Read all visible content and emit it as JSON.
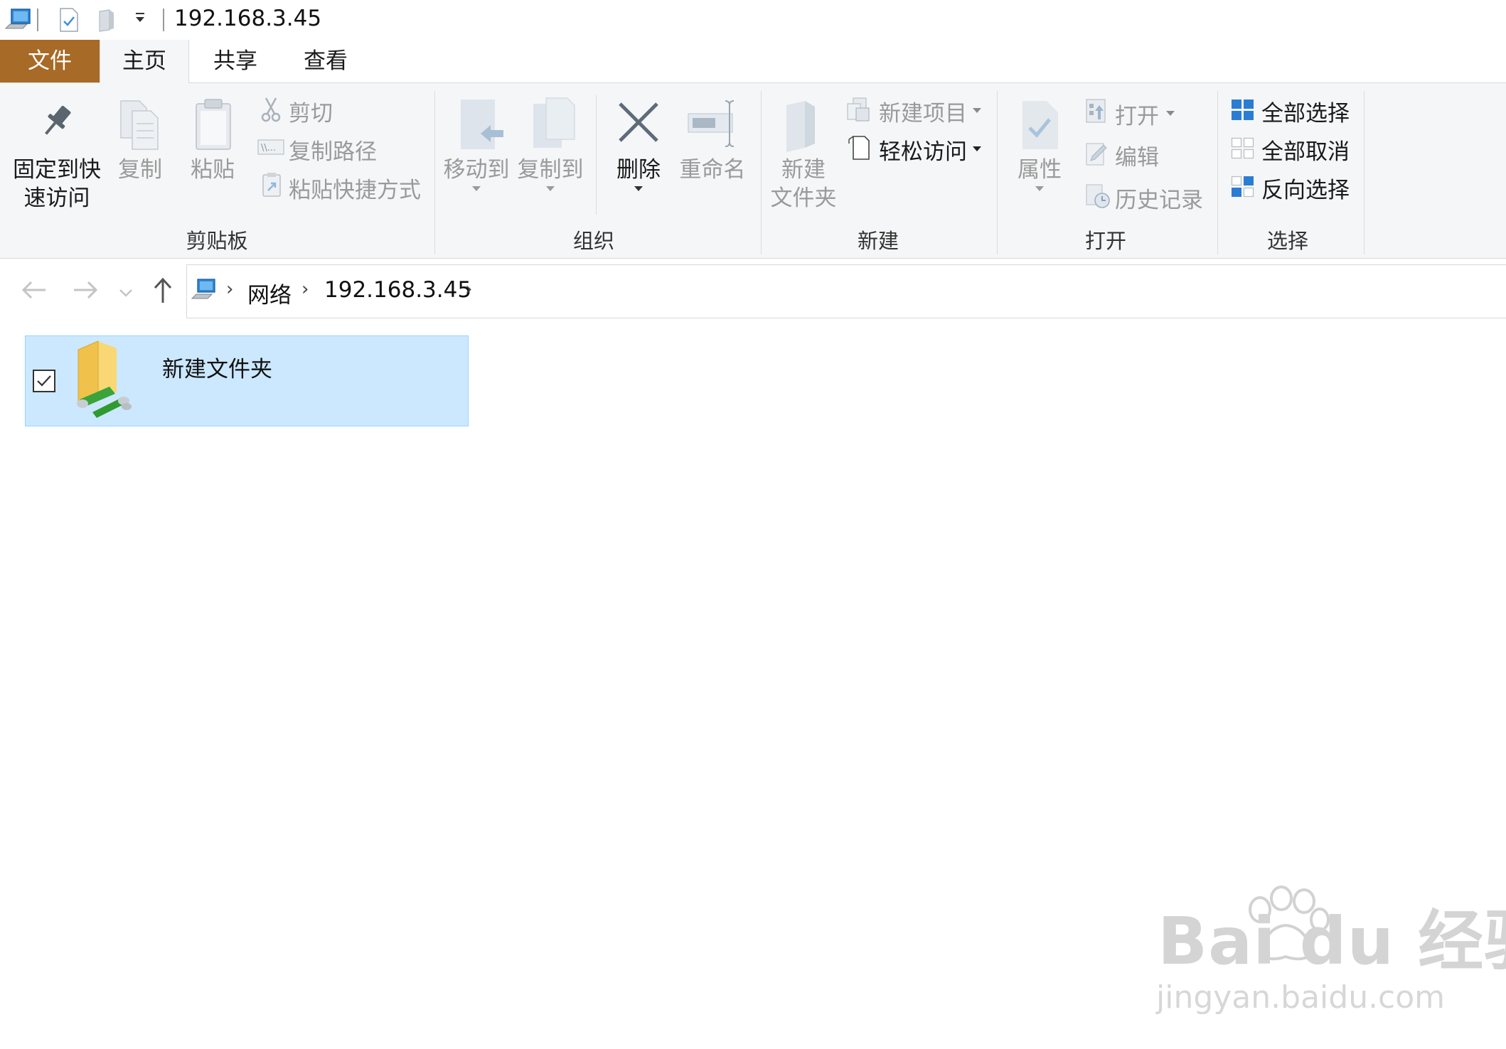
{
  "window": {
    "title": "192.168.3.45"
  },
  "tabs": [
    {
      "label": "文件"
    },
    {
      "label": "主页"
    },
    {
      "label": "共享"
    },
    {
      "label": "查看"
    }
  ],
  "ribbon": {
    "clipboard": {
      "label": "剪贴板",
      "pin_line1": "固定到快",
      "pin_line2": "速访问",
      "copy": "复制",
      "paste": "粘贴",
      "cut": "剪切",
      "copy_path": "复制路径",
      "paste_shortcut": "粘贴快捷方式"
    },
    "organize": {
      "label": "组织",
      "move_to": "移动到",
      "copy_to": "复制到",
      "delete": "删除",
      "rename": "重命名"
    },
    "new": {
      "label": "新建",
      "new_folder_line1": "新建",
      "new_folder_line2": "文件夹",
      "new_item": "新建项目",
      "easy_access": "轻松访问"
    },
    "open": {
      "label": "打开",
      "properties": "属性",
      "open": "打开",
      "edit": "编辑",
      "history": "历史记录"
    },
    "select": {
      "label": "选择",
      "select_all": "全部选择",
      "select_none": "全部取消",
      "invert": "反向选择"
    }
  },
  "breadcrumb": [
    "网络",
    "192.168.3.45"
  ],
  "files": [
    {
      "name": "新建文件夹",
      "type": "network-folder",
      "selected": true,
      "checked": true
    }
  ],
  "watermark": {
    "main": "Bai du 经验",
    "sub": "jingyan.baidu.com"
  },
  "colors": {
    "file_tab": "#a86a27",
    "selection": "#cce8ff",
    "accent_blue": "#2b7cd3"
  }
}
